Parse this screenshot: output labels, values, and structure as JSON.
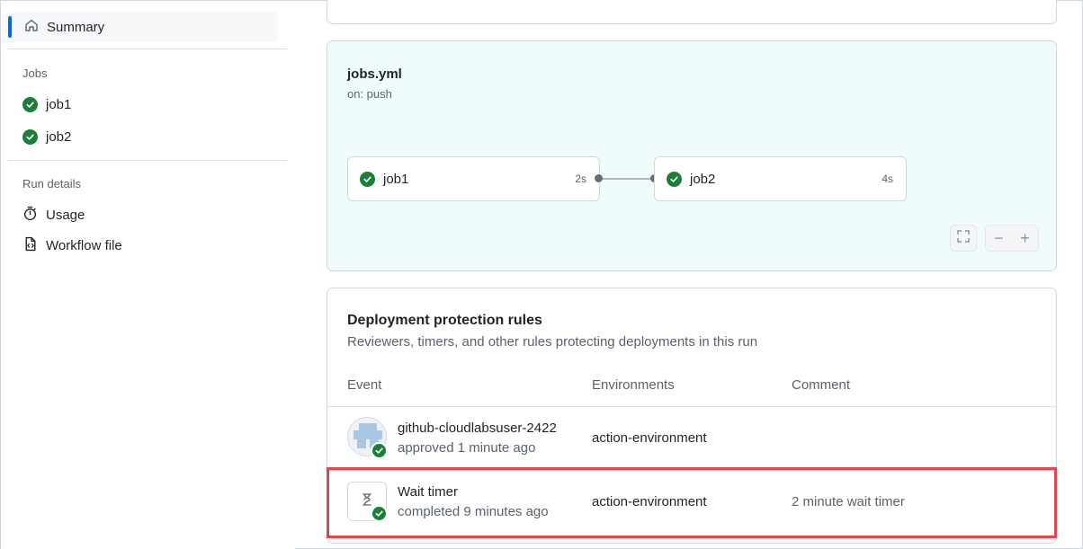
{
  "sidebar": {
    "summary_label": "Summary",
    "jobs_section": "Jobs",
    "jobs": [
      {
        "label": "job1",
        "status": "success"
      },
      {
        "label": "job2",
        "status": "success"
      }
    ],
    "run_details_section": "Run details",
    "details": [
      {
        "label": "Usage",
        "icon": "stopwatch-icon"
      },
      {
        "label": "Workflow file",
        "icon": "file-code-icon"
      }
    ]
  },
  "workflow": {
    "file_name": "jobs.yml",
    "trigger": "on: push",
    "jobs": [
      {
        "label": "job1",
        "duration": "2s"
      },
      {
        "label": "job2",
        "duration": "4s"
      }
    ],
    "controls": {
      "zoom_out": "−",
      "zoom_in": "+"
    }
  },
  "protection_rules": {
    "title": "Deployment protection rules",
    "description": "Reviewers, timers, and other rules protecting deployments in this run",
    "columns": {
      "event": "Event",
      "environments": "Environments",
      "comment": "Comment"
    },
    "rows": [
      {
        "name": "github-cloudlabsuser-2422",
        "status": "approved 1 minute ago",
        "environment": "action-environment",
        "comment": ""
      },
      {
        "name": "Wait timer",
        "status": "completed 9 minutes ago",
        "environment": "action-environment",
        "comment": "2 minute wait timer"
      }
    ]
  },
  "colors": {
    "accent": "#0969da",
    "success": "#1a7f37",
    "highlight": "#e0474c",
    "graph_bg": "#f0fbfc"
  }
}
